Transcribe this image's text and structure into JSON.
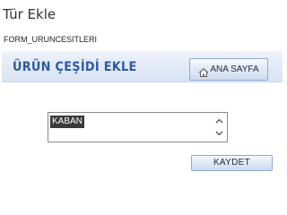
{
  "window": {
    "title": "Tür Ekle"
  },
  "form": {
    "name": "FORM_URUNCESITLERI"
  },
  "header": {
    "title": "ÜRÜN ÇEŞİDİ EKLE",
    "title_color": "#2d5aa3",
    "home_button": {
      "label": "ANA SAYFA",
      "icon": "home-icon"
    }
  },
  "listbox": {
    "items": [
      "KABAN"
    ],
    "selected_index": 0,
    "scroll_up_icon": "chevron-up-icon",
    "scroll_down_icon": "chevron-down-icon"
  },
  "actions": {
    "save_label": "KAYDET"
  }
}
